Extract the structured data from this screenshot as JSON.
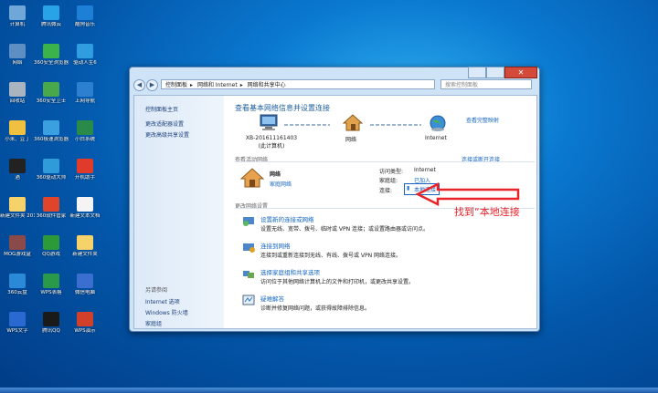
{
  "desktop": {
    "icons": [
      {
        "label": "计算机",
        "color": "#6fa7d8"
      },
      {
        "label": "腾讯微云",
        "color": "#29a3e8"
      },
      {
        "label": "酷狗音乐",
        "color": "#1e7fd6"
      },
      {
        "label": "网络",
        "color": "#5d8fc4"
      },
      {
        "label": "360安全浏览器",
        "color": "#3bb34a"
      },
      {
        "label": "驱动人生6",
        "color": "#2f9de0"
      },
      {
        "label": "回收站",
        "color": "#aab4c0"
      },
      {
        "label": "360安全卫士",
        "color": "#4aa84c"
      },
      {
        "label": "上网导航",
        "color": "#2d7fd0"
      },
      {
        "label": "小米、豆丁",
        "color": "#f0c040"
      },
      {
        "label": "360极速浏览器",
        "color": "#3aa0e0"
      },
      {
        "label": "小白系统",
        "color": "#2a8a4a"
      },
      {
        "label": "酒",
        "color": "#222222"
      },
      {
        "label": "360驱动大师",
        "color": "#2f9bd8"
      },
      {
        "label": "开机助手",
        "color": "#e03a2a"
      },
      {
        "label": "新建文件夹 2016.1...",
        "color": "#f5d36a"
      },
      {
        "label": "360软件管家",
        "color": "#e0442a"
      },
      {
        "label": "新建文本文档",
        "color": "#f4f4f4"
      },
      {
        "label": "MOG游戏盒",
        "color": "#8a4a4a"
      },
      {
        "label": "QQ游戏",
        "color": "#2d9a3a"
      },
      {
        "label": "新建文件夹",
        "color": "#f5d36a"
      },
      {
        "label": "360云盘",
        "color": "#2a8ad8"
      },
      {
        "label": "WPS表格",
        "color": "#2a9a4a"
      },
      {
        "label": "微信电脑",
        "color": "#3a6fd0"
      },
      {
        "label": "WPS文字",
        "color": "#2a6ad0"
      },
      {
        "label": "腾讯QQ",
        "color": "#1a1a1a"
      },
      {
        "label": "WPS演示",
        "color": "#d0402a"
      }
    ]
  },
  "window": {
    "close_glyph": "✕",
    "back_glyph": "◀",
    "forward_glyph": "▶",
    "address": [
      "控制面板",
      "网络和 Internet",
      "网络和共享中心"
    ],
    "address_sep": "▸",
    "search_placeholder": "搜索控制面板"
  },
  "left_pane": {
    "home": "控制面板主页",
    "links": [
      "更改适配器设置",
      "更改高级共享设置"
    ],
    "see_also_title": "另请参阅",
    "see_also": [
      "Internet 选项",
      "Windows 防火墙",
      "家庭组"
    ]
  },
  "main": {
    "title": "查看基本网络信息并设置连接",
    "full_map": "查看完整映射",
    "nodes": [
      {
        "label": "XB-201611161403\n(此计算机)"
      },
      {
        "label": "网络"
      },
      {
        "label": "Internet"
      }
    ],
    "active_title": "查看活动网络",
    "connect_disconnect": "连接或断开连接",
    "network_name": "网络",
    "network_type": "家庭网络",
    "access_type_label": "访问类型:",
    "access_type_value": "Internet",
    "homegroup_label": "家庭组:",
    "homegroup_value": "已加入",
    "connection_label": "连接:",
    "connection_value": "本地连接",
    "change_title": "更改网络设置",
    "tasks": [
      {
        "title": "设置新的连接或网络",
        "desc": "设置无线、宽带、拨号、临时或 VPN 连接；或设置路由器或访问点。"
      },
      {
        "title": "连接到网络",
        "desc": "连接到或重新连接到无线、有线、拨号或 VPN 网络连接。"
      },
      {
        "title": "选择家庭组和共享选项",
        "desc": "访问位于其他网络计算机上的文件和打印机，或更改共享设置。"
      },
      {
        "title": "疑难解答",
        "desc": "诊断并修复网络问题，或获得故障排除信息。"
      }
    ]
  },
  "annotation": {
    "text": "找到“本地连接",
    "color": "#e8232a"
  }
}
